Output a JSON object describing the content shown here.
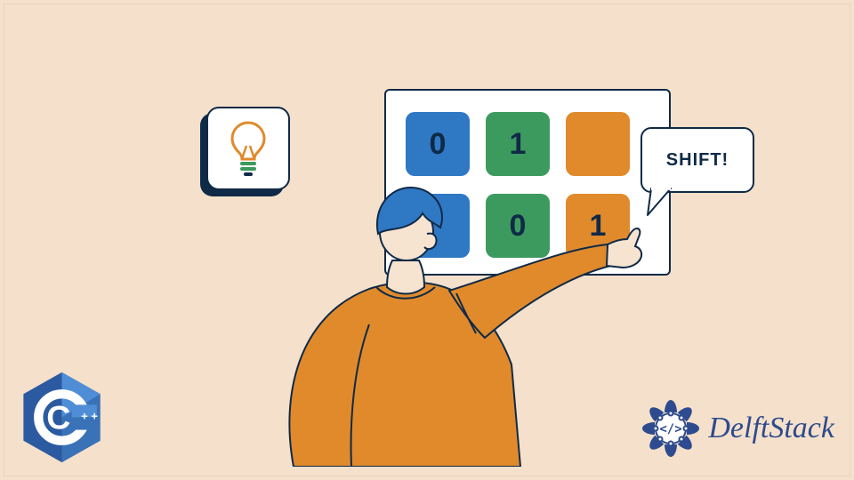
{
  "idea_card": {
    "icon": "lightbulb-icon"
  },
  "board": {
    "rows": [
      [
        {
          "color": "blue",
          "value": "0"
        },
        {
          "color": "green",
          "value": "1"
        },
        {
          "color": "orange",
          "value": ""
        }
      ],
      [
        {
          "color": "blue",
          "value": ""
        },
        {
          "color": "green",
          "value": "0"
        },
        {
          "color": "orange",
          "value": "1"
        }
      ]
    ]
  },
  "speech_bubble": {
    "text": "SHIFT!"
  },
  "person": {
    "shirt_color": "#e08a2c",
    "hair_color": "#2f78c4"
  },
  "logos": {
    "cpp": {
      "letter": "C",
      "plus": "++",
      "bg": "#2b5aa0"
    },
    "delftstack": {
      "text": "DelftStack",
      "icon_color": "#2d4b8e"
    }
  },
  "colors": {
    "background": "#f5e0cb",
    "stroke": "#0f2a47",
    "blue": "#2f78c4",
    "green": "#3c9a5f",
    "orange": "#e08a2c"
  }
}
